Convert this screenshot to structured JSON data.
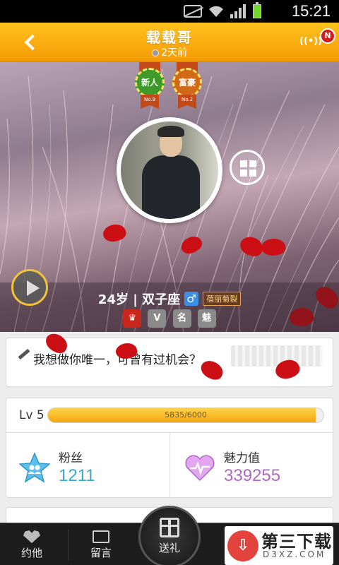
{
  "status_bar": {
    "time": "15:21"
  },
  "header": {
    "title": "载载哥",
    "last_seen": "2天前",
    "notification_badge": "N",
    "colors": {
      "bar": "#f7a80b",
      "badge": "#d31b1b"
    }
  },
  "profile": {
    "medals": [
      {
        "label": "新人",
        "rank": "No.9"
      },
      {
        "label": "富豪",
        "rank": "No.2"
      }
    ],
    "age_line": "24岁 | 双子座",
    "gender_symbol": "♂",
    "tag": "蓓丽菊裂",
    "rank_icons": [
      {
        "icon": "crown-icon",
        "glyph": "♛",
        "color": "#c8281c"
      },
      {
        "icon": "vip-icon",
        "glyph": "V",
        "color": "#8a8a8a"
      },
      {
        "icon": "famous-icon",
        "glyph": "名",
        "color": "#8a8a8a"
      },
      {
        "icon": "charm-rank-icon",
        "glyph": "魅",
        "color": "#8a8a8a"
      }
    ]
  },
  "signature": {
    "text": "我想做你唯一，可曾有过机会？"
  },
  "level": {
    "label": "Lv 5",
    "current": 5835,
    "max": 6000,
    "text": "5835/6000"
  },
  "stats": {
    "fans_label": "粉丝",
    "fans_value": "1211",
    "charm_label": "魅力值",
    "charm_value": "339255",
    "colors": {
      "fans": "#3aa7d6",
      "charm": "#b465c9"
    }
  },
  "bottom_bar": {
    "yueta": "约他",
    "liuyan": "留言",
    "gift": "送礼"
  },
  "watermark": {
    "title": "第三下载",
    "url": "D3XZ.COM"
  }
}
